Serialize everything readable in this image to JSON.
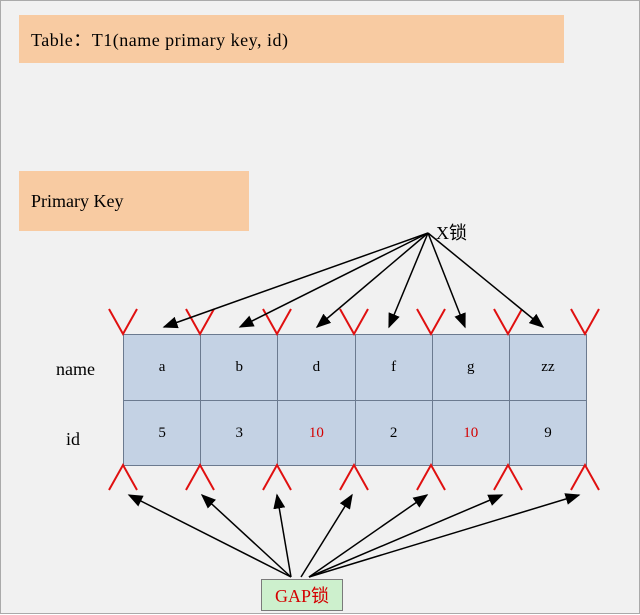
{
  "title": "Table：T1(name primary key, id)",
  "primary_key_label": "Primary Key",
  "x_lock_label": "X锁",
  "gap_lock_label": "GAP锁",
  "row_labels": {
    "name": "name",
    "id": "id"
  },
  "columns": [
    {
      "name": "a",
      "id": "5",
      "id_highlight": false
    },
    {
      "name": "b",
      "id": "3",
      "id_highlight": false
    },
    {
      "name": "d",
      "id": "10",
      "id_highlight": true
    },
    {
      "name": "f",
      "id": "2",
      "id_highlight": false
    },
    {
      "name": "g",
      "id": "10",
      "id_highlight": true
    },
    {
      "name": "zz",
      "id": "9",
      "id_highlight": false
    }
  ]
}
